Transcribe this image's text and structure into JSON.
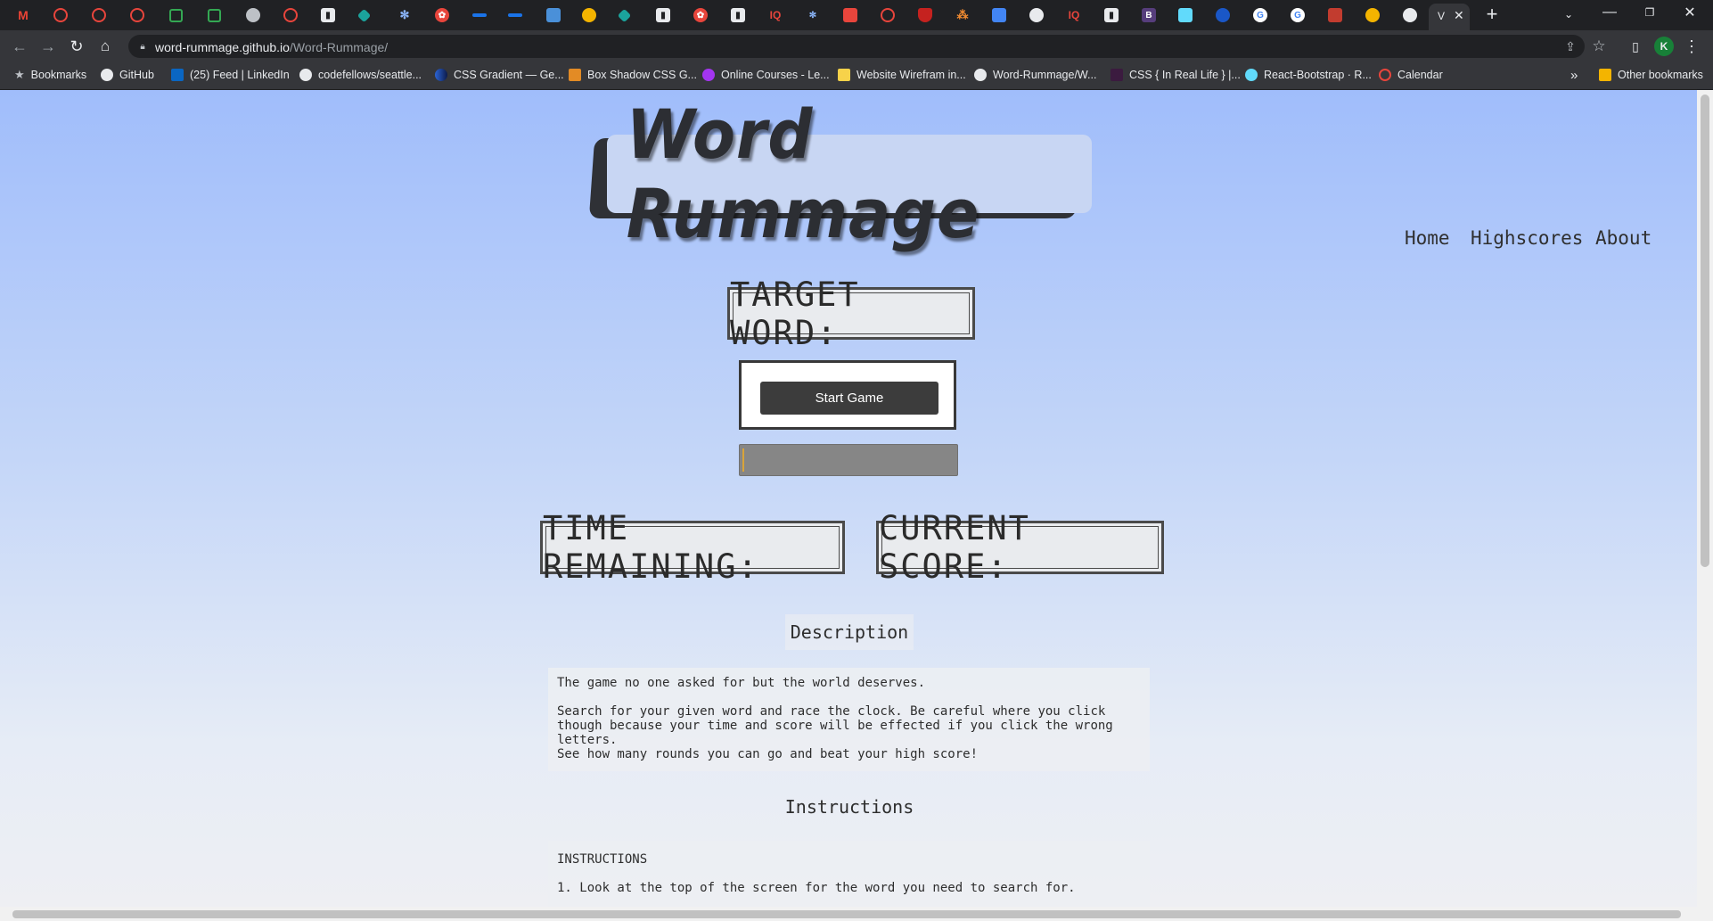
{
  "browser": {
    "url_host": "word-rummage.github.io",
    "url_path": "/Word-Rummage/",
    "profile_initial": "K",
    "active_tab_label": "V",
    "bookmarks": [
      {
        "label": "Bookmarks",
        "icon": "star-icon"
      },
      {
        "label": "GitHub",
        "icon": "github-icon"
      },
      {
        "label": "(25) Feed | LinkedIn",
        "icon": "linkedin-icon"
      },
      {
        "label": "codefellows/seattle...",
        "icon": "github-icon"
      },
      {
        "label": "CSS Gradient — Ge...",
        "icon": "gradient-icon"
      },
      {
        "label": "Box Shadow CSS G...",
        "icon": "box-icon"
      },
      {
        "label": "Online Courses - Le...",
        "icon": "udemy-icon"
      },
      {
        "label": "Website Wirefram in...",
        "icon": "wireframe-icon"
      },
      {
        "label": "Word-Rummage/W...",
        "icon": "github-icon"
      },
      {
        "label": "CSS { In Real Life } |...",
        "icon": "css-icon"
      },
      {
        "label": "React-Bootstrap · R...",
        "icon": "react-icon"
      },
      {
        "label": "Calendar",
        "icon": "calendar-icon"
      }
    ],
    "other_bookmarks": "Other bookmarks",
    "more": "»"
  },
  "site": {
    "logo_text": "Word Rummage",
    "nav": [
      "Home",
      "Highscores",
      "About"
    ]
  },
  "game": {
    "target_word_label": "TARGET WORD:",
    "start_button": "Start Game",
    "word_input_value": "",
    "time_label": "TIME REMAINING:",
    "score_label": "CURRENT SCORE:"
  },
  "description": {
    "title": "Description",
    "text": "The game no one asked for but the world deserves.\n\nSearch for your given word and race the clock. Be careful where you click\nthough because your time and score will be effected if you click the wrong\nletters.\nSee how many rounds you can go and beat your high score!"
  },
  "instructions": {
    "title": "Instructions",
    "heading": "INSTRUCTIONS",
    "step1": "1. Look at the top of the screen for the word you need to search for."
  },
  "colors": {
    "bg_top": "#a0bdfb",
    "bg_bottom": "#eeeff3",
    "button": "#3c3c3c",
    "text": "#2d2d2d"
  }
}
